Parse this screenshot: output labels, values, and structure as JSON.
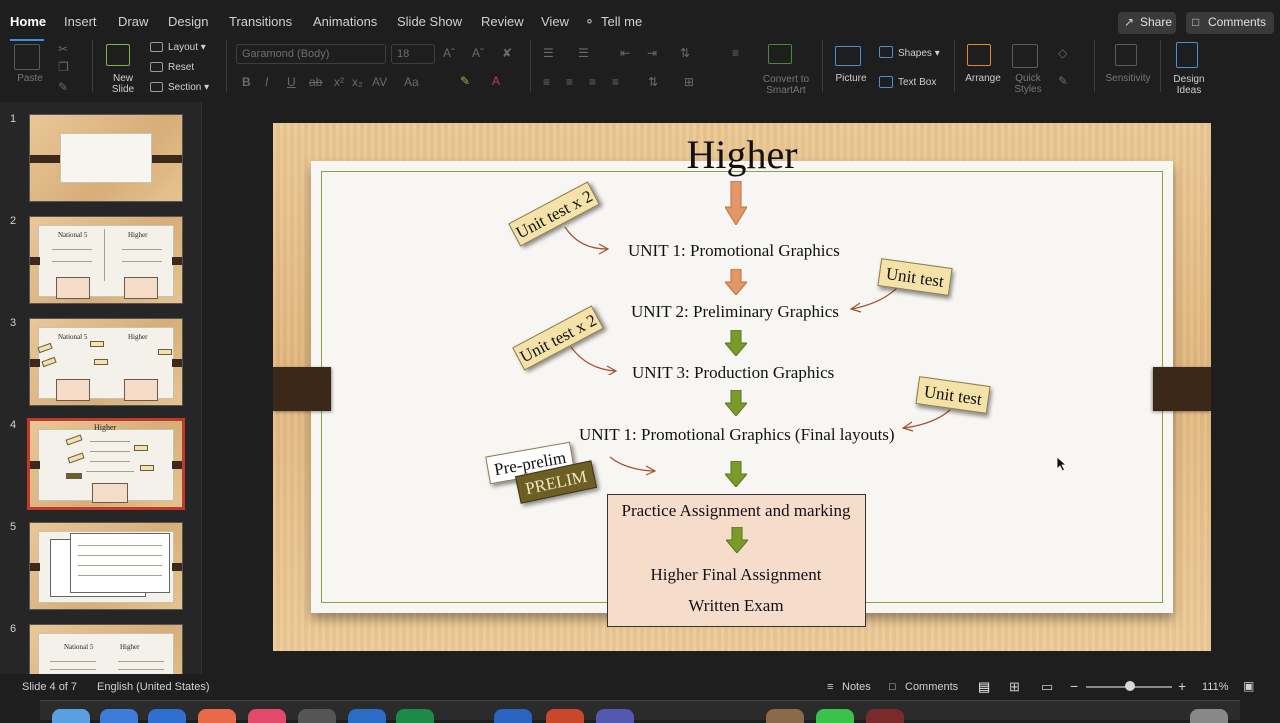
{
  "tabs": [
    "Home",
    "Insert",
    "Draw",
    "Design",
    "Transitions",
    "Animations",
    "Slide Show",
    "Review",
    "View",
    "Tell me"
  ],
  "header_buttons": {
    "share": "Share",
    "comments": "Comments"
  },
  "ribbon": {
    "paste": "Paste",
    "new_slide": [
      "New",
      "Slide"
    ],
    "layout": "Layout",
    "reset": "Reset",
    "section": "Section",
    "font_name": "Garamond (Body)",
    "font_size": "18",
    "convert_smartart": [
      "Convert to",
      "SmartArt"
    ],
    "picture": "Picture",
    "shapes": "Shapes",
    "text_box": "Text Box",
    "arrange": "Arrange",
    "quick_styles": [
      "Quick",
      "Styles"
    ],
    "sensitivity": "Sensitivity",
    "design_ideas": [
      "Design",
      "Ideas"
    ]
  },
  "thumbnails": {
    "numbers": [
      "1",
      "2",
      "3",
      "4",
      "5",
      "6"
    ],
    "selected": 4,
    "t2": {
      "left": "National 5",
      "right": "Higher"
    },
    "t3": {
      "left": "National 5",
      "right": "Higher"
    },
    "t4": {
      "title": "Higher"
    },
    "t6": {
      "left": "National 5",
      "right": "Higher"
    }
  },
  "slide": {
    "title": "Higher",
    "units": [
      "UNIT 1: Promotional Graphics",
      "UNIT 2: Preliminary Graphics",
      "UNIT 3: Production Graphics",
      "UNIT 1: Promotional Graphics (Final layouts)"
    ],
    "tags": {
      "unit_test_x2_a": "Unit test x 2",
      "unit_test_a": "Unit test",
      "unit_test_x2_b": "Unit test x 2",
      "unit_test_b": "Unit test",
      "pre_prelim": "Pre-prelim",
      "prelim": "PRELIM"
    },
    "final_box": {
      "line1": "Practice Assignment and marking",
      "line2": "Higher Final Assignment",
      "line3": "Written Exam"
    },
    "arrow_colors": {
      "orange": "#e49766",
      "green": "#7a9a2a"
    }
  },
  "status": {
    "slide_of": "Slide 4 of 7",
    "language": "English (United States)",
    "notes": "Notes",
    "comments": "Comments",
    "zoom": "111%"
  }
}
